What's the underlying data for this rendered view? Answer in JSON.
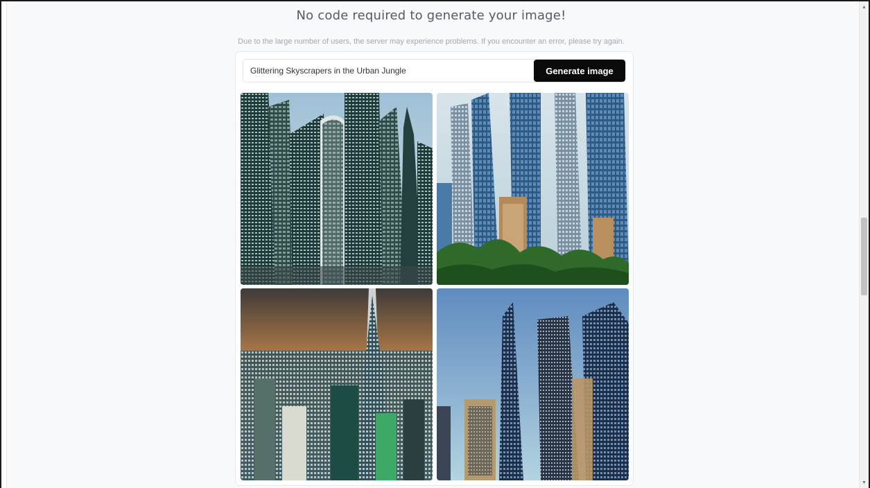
{
  "header": {
    "title": "No code required to generate your image!",
    "notice": "Due to the large number of users, the server may experience problems. If you encounter an error, please try again."
  },
  "generator": {
    "prompt_value": "Glittering Skyscrapers in the Urban Jungle",
    "generate_label": "Generate image"
  },
  "images": [
    {
      "name": "generated-image-1",
      "subject": "dense glass skyscrapers"
    },
    {
      "name": "generated-image-2",
      "subject": "tall towers above jungle trees"
    },
    {
      "name": "generated-image-3",
      "subject": "city skyline at sunset"
    },
    {
      "name": "generated-image-4",
      "subject": "blue towers against sky"
    }
  ],
  "scrollbar": {
    "up_icon": "triangle-up",
    "down_icon": "triangle-down"
  }
}
